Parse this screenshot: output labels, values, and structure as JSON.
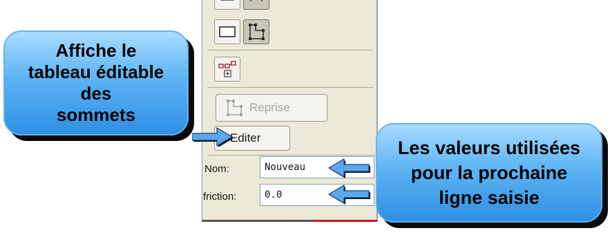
{
  "callouts": {
    "left": "Affiche le\ntableau éditable\ndes\nsommets",
    "right": "Les valeurs utilisées\npour la prochaine\nligne saisie"
  },
  "toolbar": {
    "rectangle_tool_icon": "rectangle-icon",
    "polyline_tool_icon": "polyline-edit-icon",
    "graph_tool_icon": "node-graph-icon"
  },
  "actions": {
    "reprise_label": "Reprise",
    "editer_label": "Editer"
  },
  "fields": {
    "nom_label": "Nom:",
    "nom_value": "Nouveau",
    "friction_label": "friction:",
    "friction_value": "0.0"
  },
  "colors": {
    "callout_gradient_top": "#a8dcff",
    "callout_gradient_bottom": "#2e8fe3",
    "panel_background": "#ece9d8",
    "accent_red": "#d0141c"
  }
}
